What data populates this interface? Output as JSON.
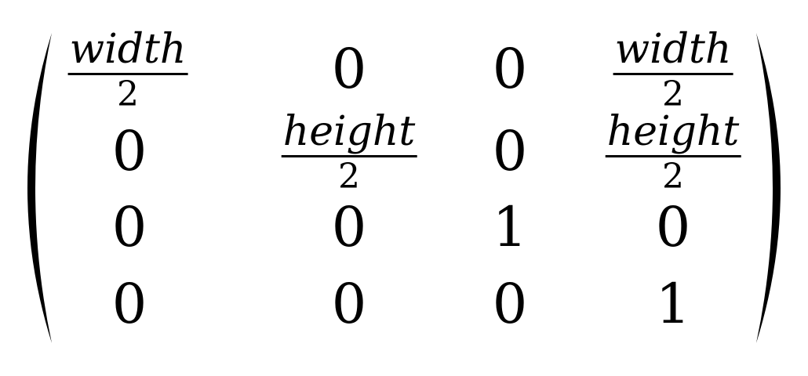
{
  "matrix": {
    "rows": [
      [
        {
          "numerator": "width",
          "denominator": "2"
        },
        {
          "text": "0"
        },
        {
          "text": "0"
        },
        {
          "numerator": "width",
          "denominator": "2"
        }
      ],
      [
        {
          "text": "0"
        },
        {
          "numerator": "height",
          "denominator": "2"
        },
        {
          "text": "0"
        },
        {
          "numerator": "height",
          "denominator": "2"
        }
      ],
      [
        {
          "text": "0"
        },
        {
          "text": "0"
        },
        {
          "text": "1"
        },
        {
          "text": "0"
        }
      ],
      [
        {
          "text": "0"
        },
        {
          "text": "0"
        },
        {
          "text": "0"
        },
        {
          "text": "1"
        }
      ]
    ]
  }
}
